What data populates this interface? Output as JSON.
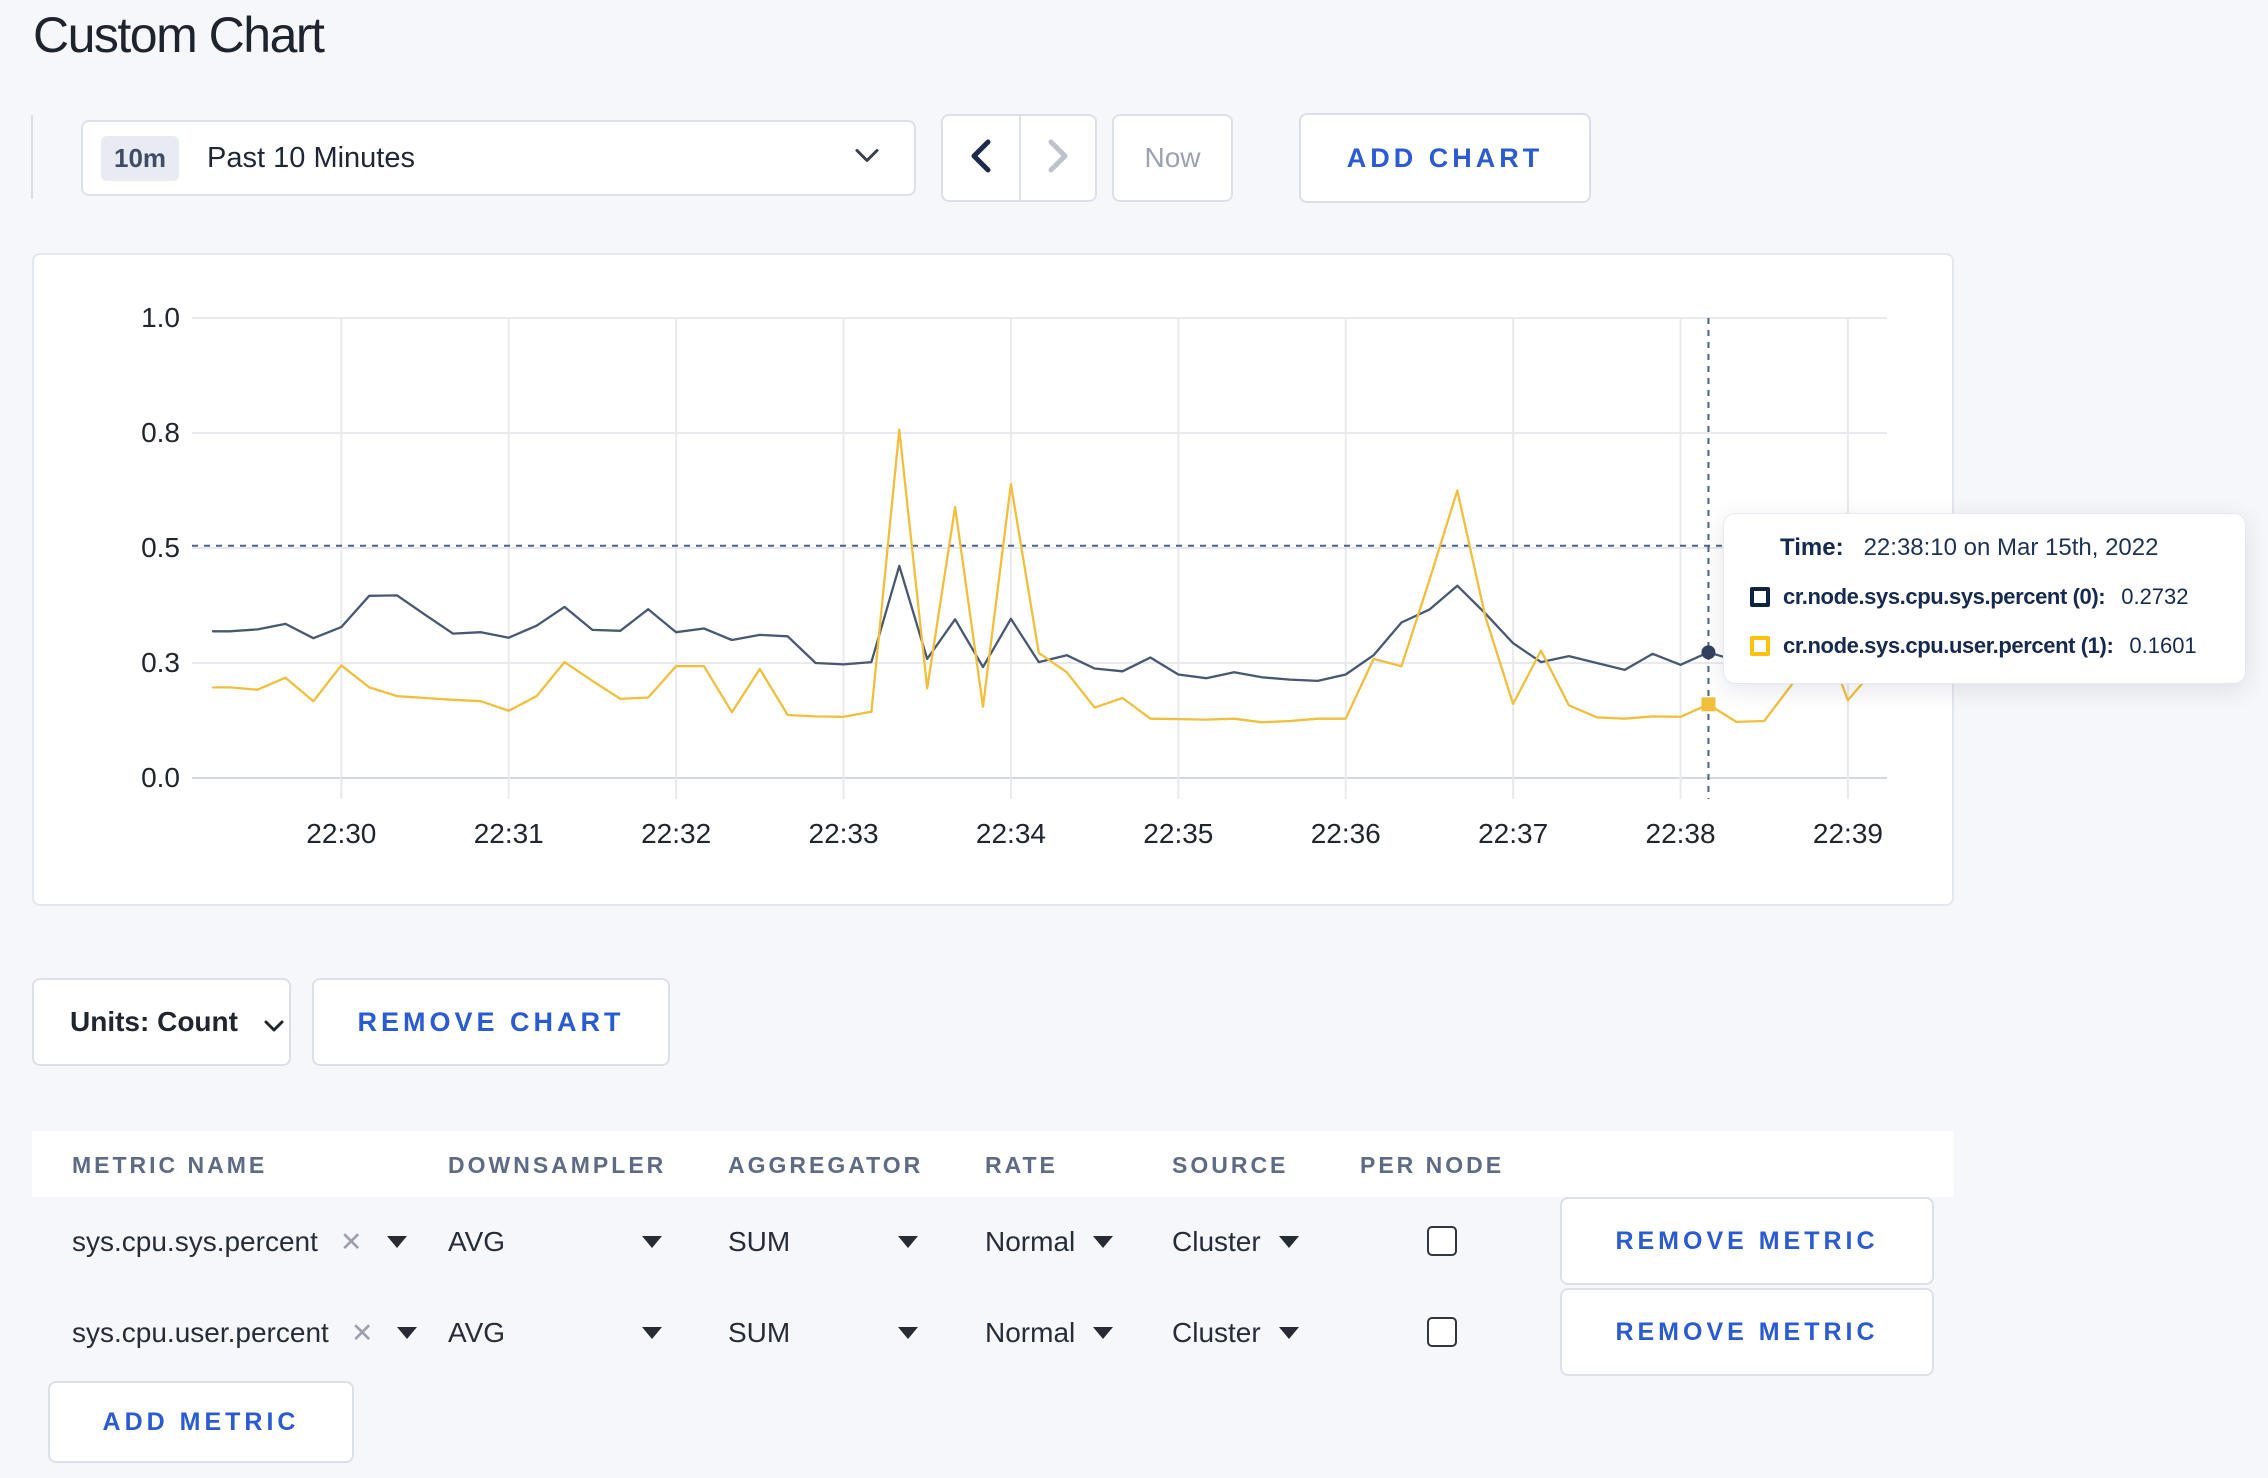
{
  "page": {
    "title": "Custom Chart",
    "background": "#f5f7fa",
    "accent_blue": "#2b5bd2"
  },
  "toolbar": {
    "time_window_badge": "10m",
    "time_window_label": "Past 10 Minutes",
    "prev_icon": "chevron-left",
    "next_icon": "chevron-right",
    "now_label": "Now",
    "add_chart_label": "ADD CHART"
  },
  "tooltip": {
    "time_label": "Time:",
    "time_value": "22:38:10 on Mar 15th, 2022",
    "series": [
      {
        "label": "cr.node.sys.cpu.sys.percent (0):",
        "value": "0.2732",
        "swatch_color": "#0e2247"
      },
      {
        "label": "cr.node.sys.cpu.user.percent (1):",
        "value": "0.1601",
        "swatch_color": "#ffc20a"
      }
    ]
  },
  "units_label": "Units: Count",
  "remove_chart_label": "REMOVE CHART",
  "table": {
    "headers": [
      "METRIC NAME",
      "DOWNSAMPLER",
      "AGGREGATOR",
      "RATE",
      "SOURCE",
      "PER NODE"
    ],
    "rows": [
      {
        "name": "sys.cpu.sys.percent",
        "downsampler": "AVG",
        "aggregator": "SUM",
        "rate": "Normal",
        "source": "Cluster",
        "per_node_checked": false,
        "remove_label": "REMOVE METRIC"
      },
      {
        "name": "sys.cpu.user.percent",
        "downsampler": "AVG",
        "aggregator": "SUM",
        "rate": "Normal",
        "source": "Cluster",
        "per_node_checked": false,
        "remove_label": "REMOVE METRIC"
      }
    ],
    "add_metric_label": "ADD METRIC"
  },
  "chart_data": {
    "type": "line",
    "title": "",
    "xlabel": "",
    "ylabel": "",
    "ylim": [
      0,
      1
    ],
    "y_ticks": [
      {
        "v": 0.0,
        "label": "0.0"
      },
      {
        "v": 0.25,
        "label": "0.3"
      },
      {
        "v": 0.5,
        "label": "0.5"
      },
      {
        "v": 0.75,
        "label": "0.8"
      },
      {
        "v": 1.0,
        "label": "1.0"
      }
    ],
    "x_minute_labels": [
      "22:30",
      "22:31",
      "22:32",
      "22:33",
      "22:34",
      "22:35",
      "22:36",
      "22:37",
      "22:38",
      "22:39"
    ],
    "sample_interval_seconds": 10,
    "first_sample": "22:29:20",
    "domain_start": "22:29:14",
    "domain_end": "22:39:14",
    "grid_on": true,
    "crosshair": {
      "time": "22:38:10",
      "seconds_from_start": 536,
      "y_value": 0.505
    },
    "series": [
      {
        "name": "cr.node.sys.cpu.sys.percent",
        "color": "#475872",
        "dot_color": "#31415f",
        "marker": "circle",
        "values": [
          0.319,
          0.323,
          0.335,
          0.304,
          0.328,
          0.396,
          0.397,
          0.355,
          0.314,
          0.317,
          0.305,
          0.331,
          0.372,
          0.322,
          0.32,
          0.367,
          0.317,
          0.325,
          0.3,
          0.311,
          0.308,
          0.25,
          0.247,
          0.252,
          0.461,
          0.259,
          0.345,
          0.241,
          0.346,
          0.252,
          0.267,
          0.238,
          0.232,
          0.262,
          0.225,
          0.217,
          0.23,
          0.219,
          0.214,
          0.211,
          0.225,
          0.267,
          0.338,
          0.366,
          0.418,
          0.358,
          0.293,
          0.252,
          0.265,
          0.25,
          0.235,
          0.27,
          0.246,
          0.2732,
          0.255,
          0.249,
          0.262,
          0.27,
          0.258,
          0.262
        ]
      },
      {
        "name": "cr.node.sys.cpu.user.percent",
        "color": "#f2bf3c",
        "dot_color": "#f2bf3c",
        "marker": "square",
        "values": [
          0.197,
          0.192,
          0.218,
          0.167,
          0.245,
          0.197,
          0.178,
          0.174,
          0.17,
          0.167,
          0.146,
          0.178,
          0.252,
          0.211,
          0.172,
          0.175,
          0.243,
          0.243,
          0.143,
          0.237,
          0.137,
          0.134,
          0.133,
          0.144,
          0.757,
          0.195,
          0.589,
          0.155,
          0.639,
          0.272,
          0.23,
          0.153,
          0.174,
          0.129,
          0.128,
          0.127,
          0.129,
          0.121,
          0.124,
          0.129,
          0.129,
          0.259,
          0.243,
          0.43,
          0.625,
          0.352,
          0.161,
          0.277,
          0.158,
          0.132,
          0.129,
          0.134,
          0.133,
          0.1601,
          0.122,
          0.124,
          0.204,
          0.33,
          0.169,
          0.24
        ]
      }
    ]
  }
}
